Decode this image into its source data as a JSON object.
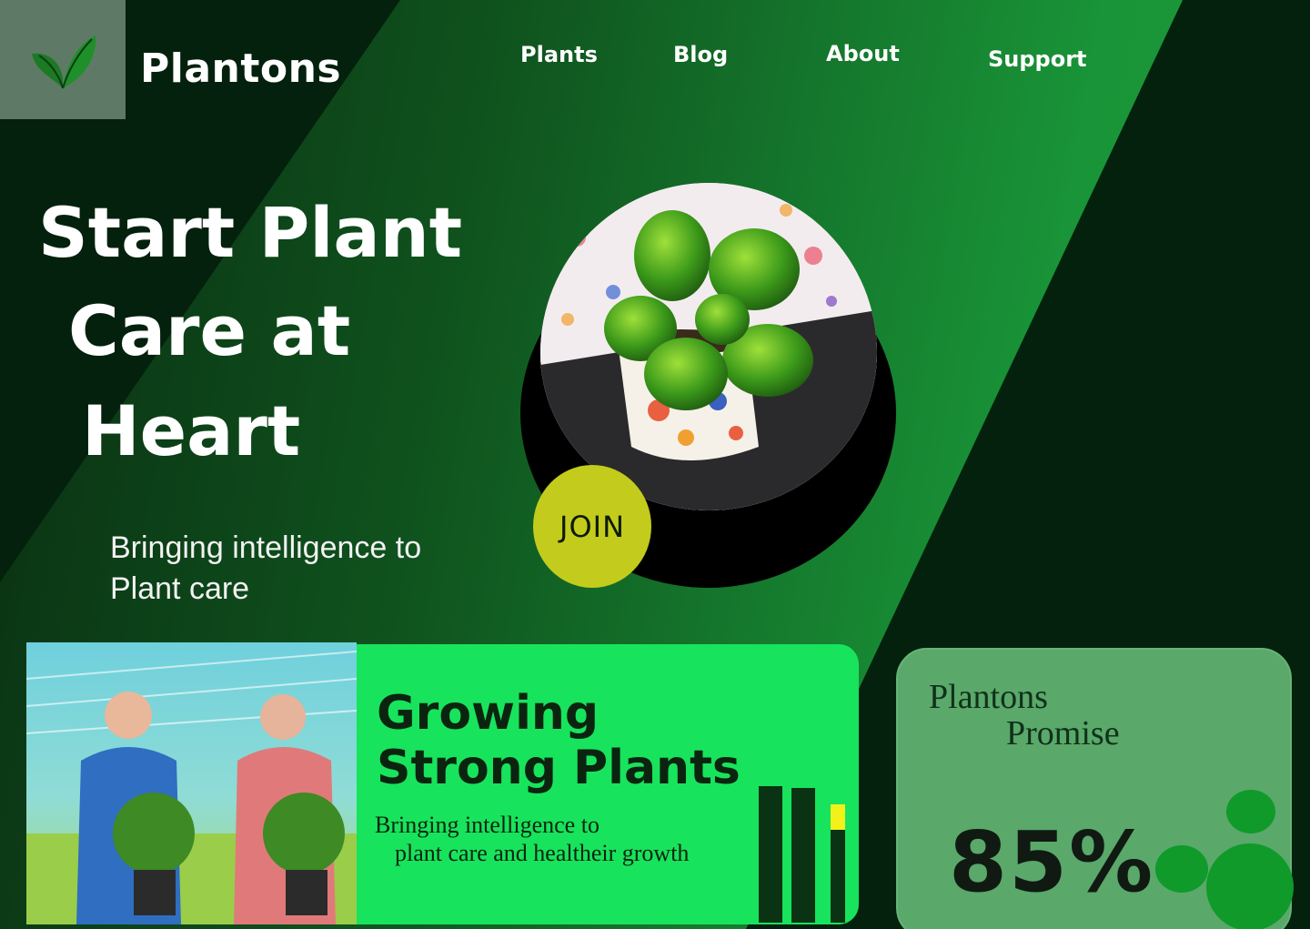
{
  "brand": {
    "name": "Plantons",
    "logo_icon": "leaf-icon"
  },
  "nav": {
    "items": [
      "Plants",
      "Blog",
      "About",
      "Support"
    ]
  },
  "hero": {
    "title_lines": [
      "Start Plant",
      "Care at",
      "Heart"
    ],
    "subtitle_lines": [
      "Bringing intelligence to",
      "Plant care"
    ],
    "image": "potted-plant-photo"
  },
  "join": {
    "label": "JOIN"
  },
  "feature": {
    "image": "two-men-holding-plants-photo",
    "title": "Growing Strong Plants",
    "subtitle_lines": [
      "Bringing intelligence to",
      "plant care and healtheir growth"
    ]
  },
  "promise": {
    "title_lines": [
      "Plantons",
      "Promise"
    ],
    "value": "85%"
  },
  "colors": {
    "background": "#04210d",
    "accent_green": "#18e35c",
    "join_yellow": "#c3cc1c",
    "promise_card": "#5aa86a"
  }
}
